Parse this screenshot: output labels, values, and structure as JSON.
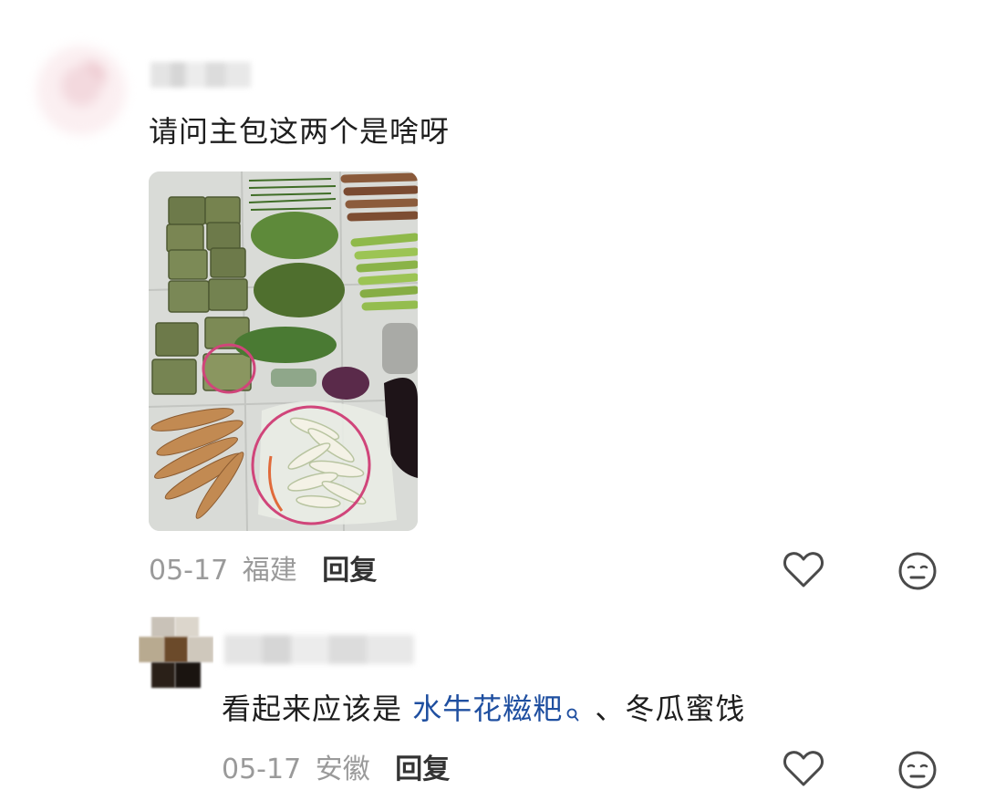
{
  "comments": [
    {
      "text": "请问主包这两个是啥呀",
      "date": "05-17",
      "location": "福建",
      "reply_label": "回复"
    },
    {
      "text_prefix": "看起来应该是 ",
      "link_text": "水牛花糍粑",
      "text_suffix": " 、冬瓜蜜饯",
      "date": "05-17",
      "location": "安徽",
      "reply_label": "回复"
    }
  ],
  "icons": {
    "like": "heart-outline-icon",
    "dislike": "neutral-face-icon",
    "link_search": "search-icon"
  },
  "colors": {
    "link": "#1f4fa0",
    "meta": "#9a9a9a",
    "annotation_circle": "#d0457a"
  }
}
